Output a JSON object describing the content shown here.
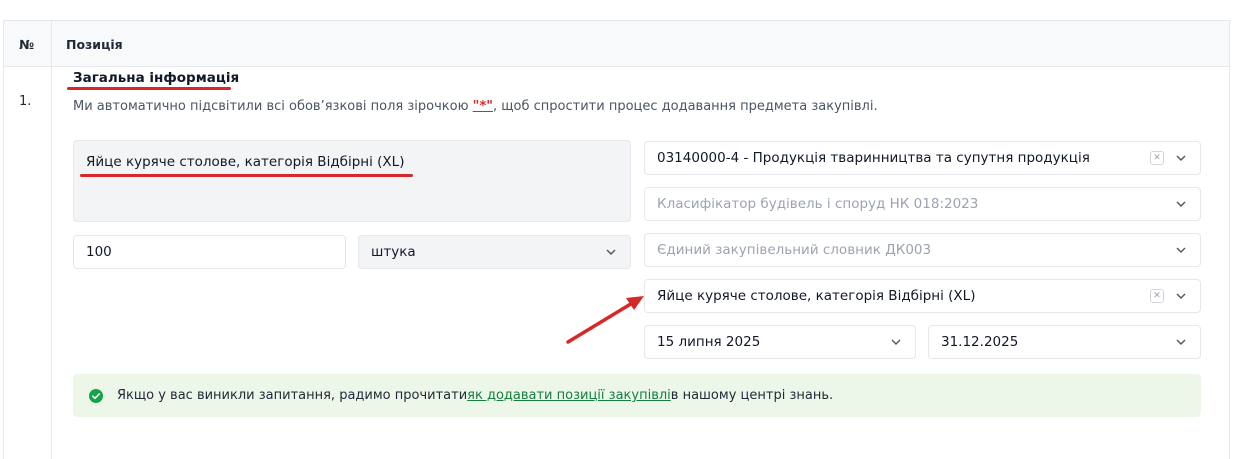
{
  "table": {
    "header_num": "№",
    "header_position": "Позиція"
  },
  "row": {
    "number": "1.",
    "section_title": "Загальна інформація",
    "description_before": "Ми автоматично підсвітили всі обов’язкові поля зірочкою ",
    "description_mark": "\"*\"",
    "description_after": ", щоб спростити процес додавання предмета закупівлі."
  },
  "fields": {
    "item_name": "Яйце куряче столове, категорія Відбірні (XL)",
    "quantity": "100",
    "unit": "штука",
    "cpv": "03140000-4 - Продукція тваринництва та супутня продукція",
    "building_classifier_placeholder": "Класифікатор будівель і споруд НК 018:2023",
    "dk003_placeholder": "Єдиний закупівельний словник ДК003",
    "item_name_classifier": "Яйце куряче столове, категорія Відбірні (XL)",
    "date_from": "15 липня 2025",
    "date_to": "31.12.2025"
  },
  "alert": {
    "text_before": "Якщо у вас виникли запитання, радимо прочитати ",
    "link_text": "як додавати позиції закупівлі",
    "text_after": " в нашому центрі знань."
  },
  "colors": {
    "annotation_red": "#d62828",
    "alert_bg": "#ecf7ea",
    "link_green": "#15803d",
    "icon_green": "#16a34a"
  },
  "icons": {
    "chevron": "chevron-down-icon",
    "clear": "clear-icon",
    "check": "check-circle-icon",
    "arrow": "annotation-arrow-icon"
  }
}
